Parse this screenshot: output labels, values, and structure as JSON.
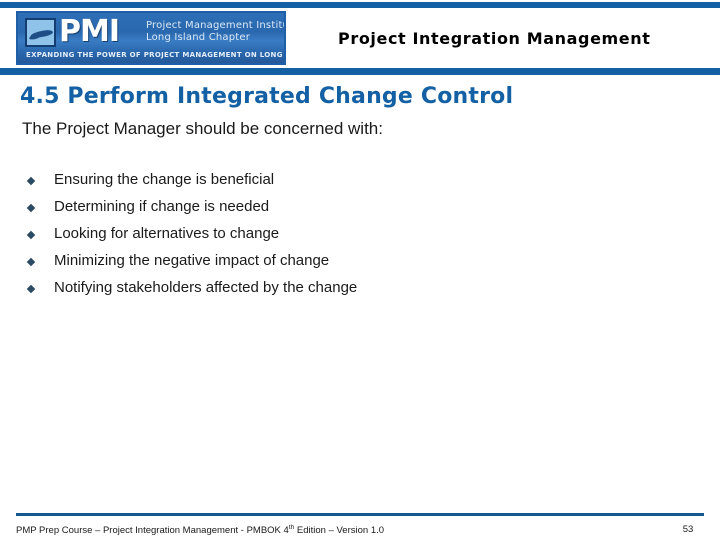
{
  "header": {
    "logo": {
      "mark_text": "PMI",
      "org_line1": "Project Management Institute",
      "org_line2": "Long Island Chapter",
      "tagline": "EXPANDING THE POWER OF PROJECT MANAGEMENT ON LONG ISLAND",
      "island_icon_name": "long-island-icon"
    },
    "title": "Project Integration Management",
    "accent_color": "#1361a4"
  },
  "body": {
    "heading": "4.5 Perform Integrated Change Control",
    "heading_color": "#1361a4",
    "lead_text": "The Project Manager should be concerned with:",
    "bullets": [
      "Ensuring the change is beneficial",
      "Determining if change is needed",
      "Looking for alternatives to change",
      "Minimizing the negative impact of change",
      "Notifying stakeholders affected by the change"
    ],
    "bullet_color": "#2b4a63"
  },
  "footer": {
    "text_before_sup": "PMP Prep Course – Project Integration Management - PMBOK 4",
    "superscript": "th",
    "text_after_sup": " Edition – Version 1.0",
    "page_number": "53",
    "rule_color": "#13588f"
  }
}
